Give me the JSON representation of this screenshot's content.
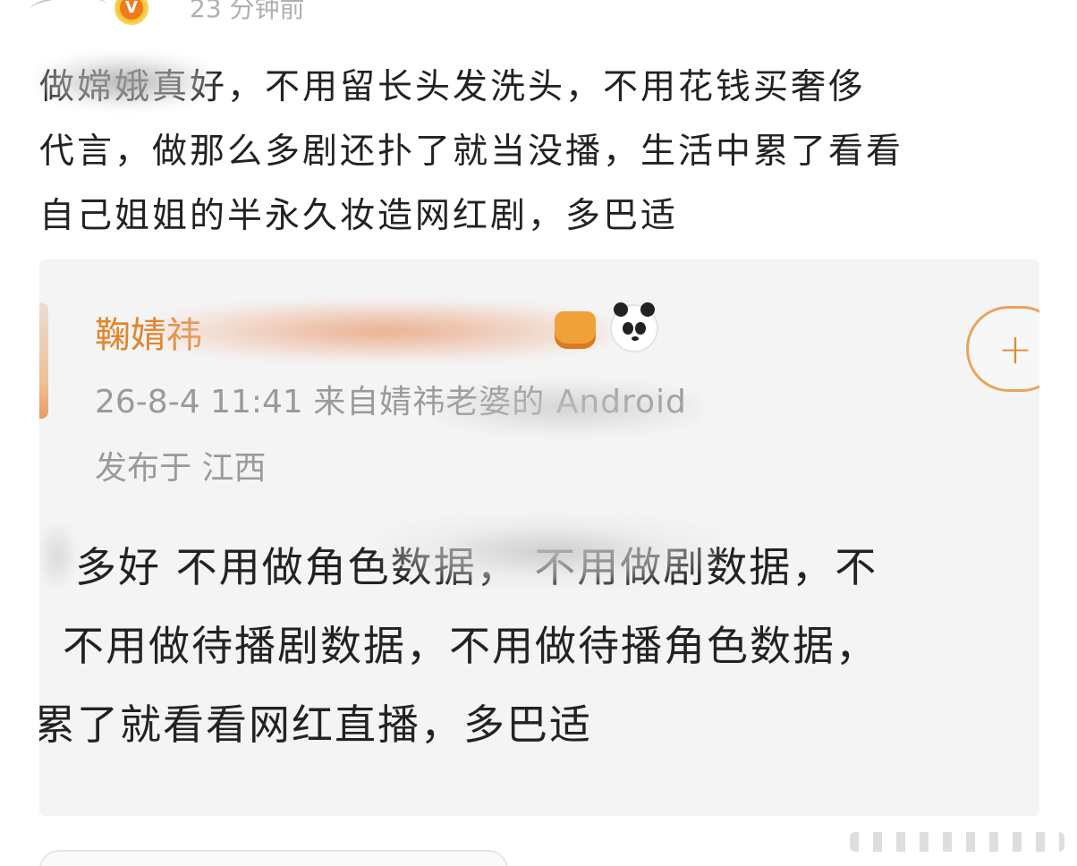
{
  "header": {
    "time": "23 分钟前",
    "verified_icon": "orange-v-badge"
  },
  "post": {
    "text_line1": "做嫦娥真好，不用留长头发洗头，不用花钱买奢侈",
    "text_line2": "代言，做那么多剧还扑了就当没播，生活中累了看看",
    "text_line3": "自己姐姐的半永久妆造网红剧，多巴适"
  },
  "embedded": {
    "name": "鞠婧祎",
    "meta_time": "26-8-4 11:41",
    "meta_source": "来自婧祎老婆的 Android",
    "location": "发布于 江西",
    "follow_label": "+",
    "body_line1": "多好 不用做角色数据， 不用做剧数据，不",
    "body_line2": "不用做待播剧数据，不用做待播角色数据，",
    "body_line3": "累了就看看网红直播，多巴适"
  },
  "colors": {
    "text": "#222222",
    "meta": "#9a9a9a",
    "accent_orange": "#e38a34",
    "card_bg": "#f4f4f4"
  }
}
